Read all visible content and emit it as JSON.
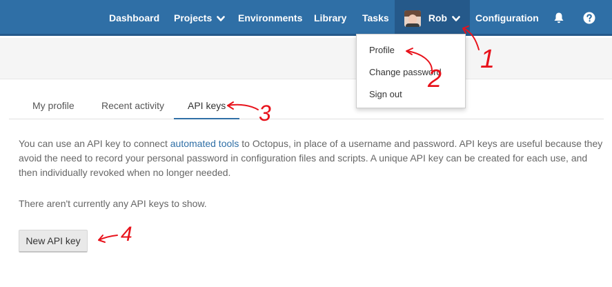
{
  "nav": {
    "items": [
      {
        "label": "Dashboard"
      },
      {
        "label": "Projects",
        "has_dropdown": true
      },
      {
        "label": "Environments"
      },
      {
        "label": "Library"
      },
      {
        "label": "Tasks"
      }
    ],
    "user": {
      "name": "Rob",
      "has_dropdown": true
    },
    "configuration": "Configuration",
    "icons": [
      "bell-icon",
      "help-icon"
    ],
    "colors": {
      "bar": "#2f6fa6",
      "active": "#25598a"
    }
  },
  "user_menu": {
    "items": [
      {
        "label": "Profile"
      },
      {
        "label": "Change password"
      },
      {
        "label": "Sign out"
      }
    ]
  },
  "tabs": [
    {
      "label": "My profile",
      "active": false
    },
    {
      "label": "Recent activity",
      "active": false
    },
    {
      "label": "API keys",
      "active": true
    }
  ],
  "content": {
    "description_pre": "You can use an API key to connect ",
    "description_link": "automated tools",
    "description_post": " to Octopus, in place of a username and password. API keys are useful because they avoid the need to record your personal password in configuration files and scripts. A unique API key can be created for each use, and then individually revoked when no longer needed.",
    "empty_message": "There aren't currently any API keys to show.",
    "new_button": "New API key"
  },
  "annotations": {
    "labels": [
      "1",
      "2",
      "3",
      "4"
    ],
    "color": "#e8121b"
  }
}
